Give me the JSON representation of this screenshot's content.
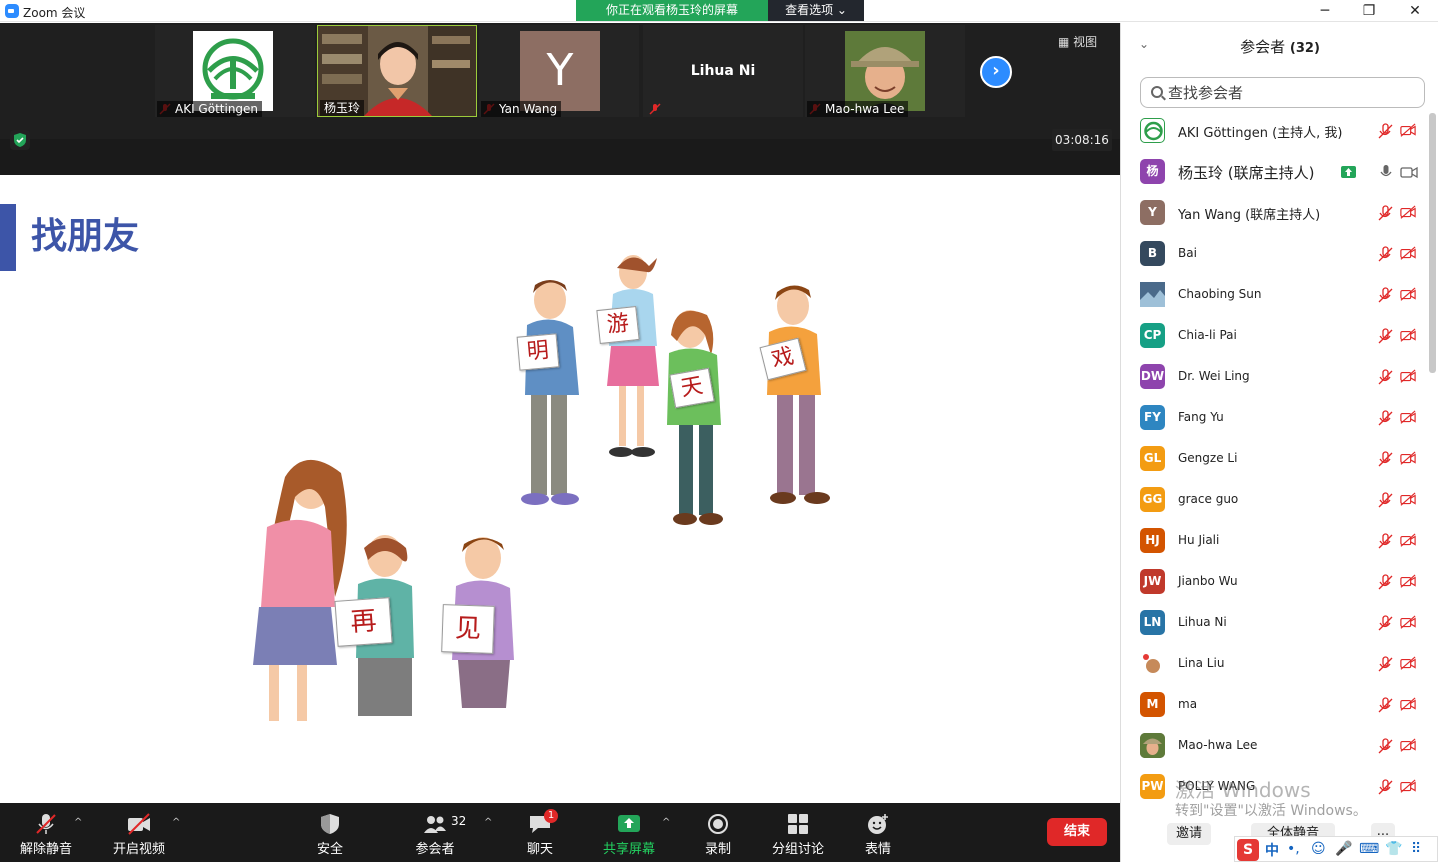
{
  "window": {
    "title": "Zoom 会议",
    "share_banner": "你正在观看杨玉玲的屏幕",
    "view_options": "查看选项 ⌄",
    "minimize": "─",
    "maximize": "❐",
    "close": "✕"
  },
  "video_strip": {
    "tiles": [
      {
        "name": "AKI Göttingen"
      },
      {
        "name": "杨玉玲"
      },
      {
        "name": "Yan Wang",
        "initial": "Y"
      },
      {
        "name": "Lihua Ni"
      },
      {
        "name": "Mao-hwa Lee"
      }
    ],
    "next": "›",
    "view_toggle": "▦ 视图",
    "timer": "03:08:16"
  },
  "slide": {
    "title": "找朋友",
    "cards": [
      "明",
      "游",
      "天",
      "戏",
      "再",
      "见"
    ]
  },
  "toolbar": {
    "unmute": "解除静音",
    "start_video": "开启视频",
    "security": "安全",
    "participants": "参会者",
    "participants_count": "32",
    "chat": "聊天",
    "chat_badge": "1",
    "share_screen": "共享屏幕",
    "record": "录制",
    "breakout": "分组讨论",
    "reactions": "表情",
    "end": "结束"
  },
  "panel": {
    "collapse": "⌄",
    "title": "参会者",
    "count": "(32)",
    "search_placeholder": "查找参会者",
    "participants": [
      {
        "name": "AKI Göttingen (主持人, 我)",
        "initial": "",
        "color": "#ffffff"
      },
      {
        "name": "杨玉玲 (联席主持人)",
        "initial": "杨",
        "color": "#8e44ad"
      },
      {
        "name": "Yan Wang (联席主持人)",
        "initial": "Y",
        "color": "#8d6e63"
      },
      {
        "name": "Bai",
        "initial": "B",
        "color": "#34495e"
      },
      {
        "name": "Chaobing Sun",
        "initial": "",
        "color": "#5a7d9a"
      },
      {
        "name": "Chia-li Pai",
        "initial": "CP",
        "color": "#16a085"
      },
      {
        "name": "Dr. Wei Ling",
        "initial": "DW",
        "color": "#8e44ad"
      },
      {
        "name": "Fang Yu",
        "initial": "FY",
        "color": "#2e86c1"
      },
      {
        "name": "Gengze Li",
        "initial": "GL",
        "color": "#f39c12"
      },
      {
        "name": "grace guo",
        "initial": "GG",
        "color": "#f39c12"
      },
      {
        "name": "Hu Jiali",
        "initial": "HJ",
        "color": "#d35400"
      },
      {
        "name": "Jianbo Wu",
        "initial": "JW",
        "color": "#c0392b"
      },
      {
        "name": "Lihua Ni",
        "initial": "LN",
        "color": "#2874a6"
      },
      {
        "name": "Lina Liu",
        "initial": "",
        "color": "#f5e6d3"
      },
      {
        "name": "ma",
        "initial": "M",
        "color": "#d35400"
      },
      {
        "name": "Mao-hwa Lee",
        "initial": "",
        "color": "#7a6a4f"
      },
      {
        "name": "POLLY WANG",
        "initial": "PW",
        "color": "#f39c12"
      }
    ],
    "invite": "邀请",
    "mute_all": "全体静音",
    "more": "..."
  },
  "watermark": {
    "line1": "激活 Windows",
    "line2": "转到\"设置\"以激活 Windows。"
  },
  "ime": {
    "logo": "S",
    "mode": "中",
    "glyphs": [
      "•,",
      "☺",
      "🎤",
      "⌨",
      "👕",
      "⠿"
    ]
  }
}
